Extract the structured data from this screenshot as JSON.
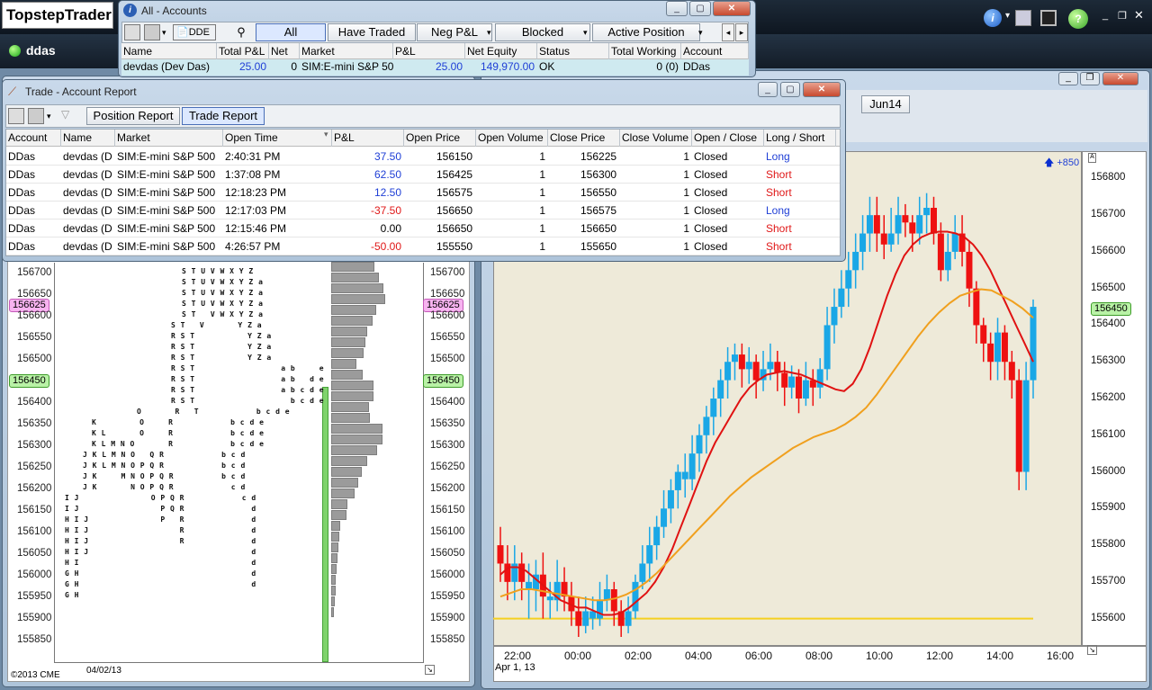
{
  "app": {
    "brand": "TopstepTrader",
    "account_badge": "ddas"
  },
  "accounts_window": {
    "title": "All - Accounts",
    "toolbar": {
      "dde_label": "DDE"
    },
    "tabs": [
      "All",
      "Have Traded",
      "Neg P&L",
      "Blocked",
      "Active Position"
    ],
    "columns": [
      "Name",
      "Total P&L",
      "Net",
      "Market",
      "P&L",
      "Net Equity",
      "Status",
      "Total Working",
      "Account"
    ],
    "row": {
      "name": "devdas (Dev Das)",
      "total_pl": "25.00",
      "net": "0",
      "market": "SIM:E-mini S&P 50",
      "pl": "25.00",
      "net_equity": "149,970.00",
      "status": "OK",
      "total_working": "0 (0)",
      "account": "DDas"
    }
  },
  "report_window": {
    "title": "Trade - Account Report",
    "tabs": [
      "Position Report",
      "Trade Report"
    ],
    "columns": [
      "Account",
      "Name",
      "Market",
      "Open Time",
      "P&L",
      "Open Price",
      "Open Volume",
      "Close Price",
      "Close Volume",
      "Open / Close",
      "Long / Short"
    ],
    "rows": [
      {
        "account": "DDas",
        "name": "devdas (D",
        "market": "SIM:E-mini S&P 500",
        "open_time": "2:40:31 PM",
        "pl": "37.50",
        "open_price": "156150",
        "open_volume": "1",
        "close_price": "156225",
        "close_volume": "1",
        "open_close": "Closed",
        "long_short": "Long"
      },
      {
        "account": "DDas",
        "name": "devdas (D",
        "market": "SIM:E-mini S&P 500",
        "open_time": "1:37:08 PM",
        "pl": "62.50",
        "open_price": "156425",
        "open_volume": "1",
        "close_price": "156300",
        "close_volume": "1",
        "open_close": "Closed",
        "long_short": "Short"
      },
      {
        "account": "DDas",
        "name": "devdas (D",
        "market": "SIM:E-mini S&P 500",
        "open_time": "12:18:23 PM",
        "pl": "12.50",
        "open_price": "156575",
        "open_volume": "1",
        "close_price": "156550",
        "close_volume": "1",
        "open_close": "Closed",
        "long_short": "Short"
      },
      {
        "account": "DDas",
        "name": "devdas (D",
        "market": "SIM:E-mini S&P 500",
        "open_time": "12:17:03 PM",
        "pl": "-37.50",
        "open_price": "156650",
        "open_volume": "1",
        "close_price": "156575",
        "close_volume": "1",
        "open_close": "Closed",
        "long_short": "Long"
      },
      {
        "account": "DDas",
        "name": "devdas (D",
        "market": "SIM:E-mini S&P 500",
        "open_time": "12:15:46 PM",
        "pl": "0.00",
        "open_price": "156650",
        "open_volume": "1",
        "close_price": "156650",
        "close_volume": "1",
        "open_close": "Closed",
        "long_short": "Short"
      },
      {
        "account": "DDas",
        "name": "devdas (D",
        "market": "SIM:E-mini S&P 500",
        "open_time": "4:26:57 PM",
        "pl": "-50.00",
        "open_price": "155550",
        "open_volume": "1",
        "close_price": "155650",
        "close_volume": "1",
        "open_close": "Closed",
        "long_short": "Short"
      }
    ]
  },
  "profile_chart": {
    "copyright": "©2013 CME",
    "date": "04/02/13",
    "price_labels": [
      "156700",
      "156650",
      "156600",
      "156550",
      "156500",
      "156450",
      "156400",
      "156350",
      "156300",
      "156250",
      "156200",
      "156150",
      "156100",
      "156050",
      "156000",
      "155950",
      "155900",
      "155850"
    ],
    "highlight_pink": "156625",
    "highlight_green": "156450",
    "tpo_rows": [
      "S T U V W X Y Z",
      "S T U V W X Y Z a",
      "S T U V W X Y Z a",
      "S T U V W X Y Z a",
      "S T   V W X Y Z a",
      "S T   V       Y Z a",
      "R S T           Y Z a",
      "R S T           Y Z a",
      "R S T           Y Z a",
      "R S T                  a b     e",
      "R S T                  a b   d e",
      "R S T                  a b c d e",
      "R S T                    b c d e",
      "O       R   T            b c d e",
      "K         O     R            b c d e",
      "K L       O     R            b c d e",
      "K L M N O       R            b c d e",
      "J K L M N O   Q R            b c d",
      "J K L M N O P Q R            b c d",
      "J K     M N O P Q R          b c d",
      "J K       N O P Q R            c d",
      "I J               O P Q R            c d",
      "I J                 P Q R              d",
      "H I J               P   R              d",
      "H I J                   R              d",
      "H I J                   R              d",
      "H I J                                  d",
      "H I                                    d",
      "G H                                    d",
      "G H                                    d",
      "G H"
    ],
    "volume_values": [
      48,
      53,
      58,
      60,
      50,
      46,
      40,
      38,
      36,
      28,
      35,
      47,
      47,
      42,
      43,
      57,
      57,
      51,
      40,
      34,
      30,
      26,
      18,
      17,
      10,
      9,
      8,
      7,
      6,
      5,
      5,
      4,
      3
    ],
    "green_bar_values": [
      30,
      28,
      26,
      24,
      22,
      20,
      18,
      16,
      14,
      12,
      10,
      9,
      8,
      7,
      6,
      5,
      4,
      3,
      2,
      2,
      2,
      2,
      2
    ]
  },
  "candle_chart": {
    "contract_tab": "Jun14",
    "change_label": "+850",
    "last_price": "156450",
    "date_label": "Apr 1, 13",
    "chart_data": {
      "type": "candlestick",
      "x_ticks": [
        "22:00",
        "00:00",
        "02:00",
        "04:00",
        "06:00",
        "08:00",
        "10:00",
        "12:00",
        "14:00",
        "16:00"
      ],
      "y_ticks": [
        "156800",
        "156700",
        "156600",
        "156500",
        "156400",
        "156300",
        "156200",
        "156100",
        "156000",
        "155900",
        "155800",
        "155700",
        "155600"
      ],
      "ylim": [
        155550,
        156850
      ],
      "candles": [
        [
          155800,
          155750,
          155850,
          155700,
          "r"
        ],
        [
          155750,
          155700,
          155800,
          155650,
          "r"
        ],
        [
          155700,
          155750,
          155800,
          155650,
          "b"
        ],
        [
          155750,
          155700,
          155780,
          155650,
          "r"
        ],
        [
          155700,
          155680,
          155750,
          155600,
          "b"
        ],
        [
          155680,
          155720,
          155760,
          155620,
          "b"
        ],
        [
          155720,
          155660,
          155780,
          155600,
          "r"
        ],
        [
          155660,
          155650,
          155700,
          155600,
          "b"
        ],
        [
          155650,
          155700,
          155760,
          155620,
          "b"
        ],
        [
          155700,
          155660,
          155740,
          155620,
          "r"
        ],
        [
          155660,
          155620,
          155700,
          155580,
          "r"
        ],
        [
          155620,
          155580,
          155660,
          155550,
          "r"
        ],
        [
          155580,
          155620,
          155660,
          155560,
          "b"
        ],
        [
          155620,
          155600,
          155660,
          155570,
          "b"
        ],
        [
          155600,
          155650,
          155700,
          155580,
          "b"
        ],
        [
          155650,
          155680,
          155720,
          155620,
          "b"
        ],
        [
          155680,
          155620,
          155700,
          155580,
          "r"
        ],
        [
          155620,
          155580,
          155650,
          155550,
          "r"
        ],
        [
          155580,
          155620,
          155660,
          155560,
          "b"
        ],
        [
          155620,
          155700,
          155720,
          155600,
          "b"
        ],
        [
          155700,
          155750,
          155800,
          155680,
          "b"
        ],
        [
          155750,
          155800,
          155850,
          155700,
          "b"
        ],
        [
          155800,
          155850,
          155880,
          155760,
          "b"
        ],
        [
          155850,
          155900,
          155950,
          155820,
          "b"
        ],
        [
          155900,
          155950,
          155980,
          155860,
          "b"
        ],
        [
          155950,
          156000,
          156020,
          155900,
          "b"
        ],
        [
          156000,
          155980,
          156050,
          155930,
          "b"
        ],
        [
          155980,
          156050,
          156100,
          155950,
          "b"
        ],
        [
          156050,
          156100,
          156130,
          156000,
          "b"
        ],
        [
          156100,
          156150,
          156180,
          156050,
          "b"
        ],
        [
          156150,
          156200,
          156230,
          156100,
          "b"
        ],
        [
          156200,
          156250,
          156280,
          156150,
          "b"
        ],
        [
          156250,
          156300,
          156340,
          156200,
          "b"
        ],
        [
          156300,
          156320,
          156350,
          156250,
          "b"
        ],
        [
          156320,
          156280,
          156350,
          156230,
          "r"
        ],
        [
          156280,
          156300,
          156340,
          156240,
          "b"
        ],
        [
          156300,
          156250,
          156320,
          156200,
          "r"
        ],
        [
          156250,
          156280,
          156330,
          156220,
          "b"
        ],
        [
          156280,
          156300,
          156350,
          156250,
          "b"
        ],
        [
          156300,
          156270,
          156330,
          156220,
          "r"
        ],
        [
          156270,
          156230,
          156300,
          156180,
          "r"
        ],
        [
          156230,
          156260,
          156290,
          156200,
          "b"
        ],
        [
          156260,
          156200,
          156280,
          156160,
          "r"
        ],
        [
          156200,
          156250,
          156300,
          156180,
          "b"
        ],
        [
          156250,
          156230,
          156280,
          156180,
          "r"
        ],
        [
          156230,
          156280,
          156310,
          156200,
          "b"
        ],
        [
          156280,
          156400,
          156450,
          156250,
          "b"
        ],
        [
          156400,
          156450,
          156500,
          156350,
          "b"
        ],
        [
          156450,
          156500,
          156550,
          156420,
          "b"
        ],
        [
          156500,
          156550,
          156600,
          156450,
          "b"
        ],
        [
          156550,
          156600,
          156650,
          156500,
          "b"
        ],
        [
          156600,
          156650,
          156700,
          156550,
          "b"
        ],
        [
          156650,
          156700,
          156750,
          156600,
          "b"
        ],
        [
          156700,
          156650,
          156750,
          156600,
          "r"
        ],
        [
          156650,
          156620,
          156700,
          156580,
          "r"
        ],
        [
          156620,
          156650,
          156720,
          156600,
          "b"
        ],
        [
          156650,
          156700,
          156750,
          156620,
          "b"
        ],
        [
          156700,
          156680,
          156730,
          156640,
          "r"
        ],
        [
          156680,
          156650,
          156700,
          156600,
          "r"
        ],
        [
          156650,
          156700,
          156750,
          156620,
          "b"
        ],
        [
          156700,
          156720,
          156760,
          156650,
          "b"
        ],
        [
          156720,
          156650,
          156750,
          156620,
          "r"
        ],
        [
          156650,
          156550,
          156680,
          156520,
          "r"
        ],
        [
          156550,
          156600,
          156650,
          156520,
          "b"
        ],
        [
          156600,
          156650,
          156700,
          156580,
          "b"
        ],
        [
          156650,
          156600,
          156700,
          156560,
          "r"
        ],
        [
          156600,
          156500,
          156630,
          156450,
          "r"
        ],
        [
          156500,
          156400,
          156520,
          156350,
          "r"
        ],
        [
          156400,
          156350,
          156420,
          156300,
          "r"
        ],
        [
          156350,
          156300,
          156380,
          156250,
          "r"
        ],
        [
          156300,
          156380,
          156420,
          156250,
          "b"
        ],
        [
          156380,
          156300,
          156400,
          156250,
          "r"
        ],
        [
          156300,
          156250,
          156330,
          156200,
          "r"
        ],
        [
          156250,
          156000,
          156280,
          155950,
          "r"
        ],
        [
          156000,
          156250,
          156300,
          155950,
          "b"
        ],
        [
          156250,
          156450,
          156470,
          156200,
          "b"
        ]
      ],
      "series": [
        {
          "name": "",
          "color": "#e01212",
          "values": [
            155720,
            155740,
            155740,
            155730,
            155710,
            155690,
            155670,
            155650,
            155640,
            155630,
            155630,
            155620,
            155610,
            155610,
            155615,
            155630,
            155650,
            155670,
            155700,
            155740,
            155790,
            155850,
            155910,
            155970,
            156030,
            156080,
            156120,
            156160,
            156200,
            156230,
            156250,
            156265,
            156270,
            156275,
            156270,
            156265,
            156255,
            156245,
            156235,
            156225,
            156220,
            156240,
            156280,
            156340,
            156410,
            156480,
            156540,
            156590,
            156620,
            156640,
            156650,
            156655,
            156655,
            156650,
            156640,
            156620,
            156590,
            156550,
            156500,
            156450,
            156400,
            156350,
            156300
          ]
        },
        {
          "name": "",
          "color": "#f0a01e",
          "values": [
            155660,
            155670,
            155680,
            155680,
            155675,
            155670,
            155665,
            155660,
            155655,
            155650,
            155650,
            155655,
            155665,
            155680,
            155700,
            155725,
            155755,
            155785,
            155815,
            155845,
            155875,
            155905,
            155935,
            155960,
            155985,
            156005,
            156025,
            156045,
            156065,
            156080,
            156095,
            156105,
            156115,
            156130,
            156150,
            156175,
            156210,
            156250,
            156290,
            156330,
            156370,
            156405,
            156435,
            156460,
            156480,
            156490,
            156498,
            156495,
            156480,
            156465,
            156445,
            156420
          ]
        }
      ],
      "reference_line": {
        "value": 155600,
        "color": "#f5d020"
      }
    }
  }
}
